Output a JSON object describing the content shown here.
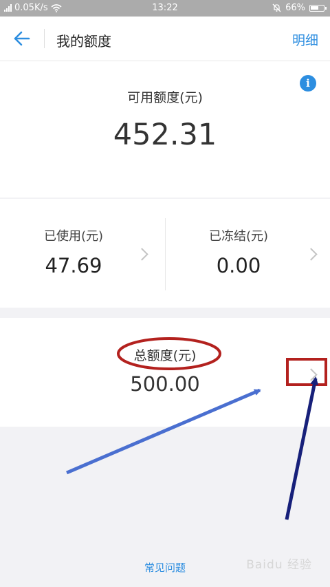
{
  "status_bar": {
    "network_speed": "0.05K/s",
    "time": "13:22",
    "battery": "66%",
    "battery_level": 0.66
  },
  "nav": {
    "title": "我的额度",
    "detail_link": "明细"
  },
  "available": {
    "label": "可用额度(元)",
    "value": "452.31"
  },
  "used": {
    "label": "已使用(元)",
    "value": "47.69"
  },
  "frozen": {
    "label": "已冻结(元)",
    "value": "0.00"
  },
  "total": {
    "label": "总额度(元)",
    "value": "500.00"
  },
  "faq_link": "常见问题",
  "watermark": "Baidu 经验",
  "colors": {
    "accent": "#2d8ee0",
    "annotation_red": "#b3211e",
    "arrow_blue_light": "#4a6fd0",
    "arrow_blue_dark": "#17207a"
  }
}
